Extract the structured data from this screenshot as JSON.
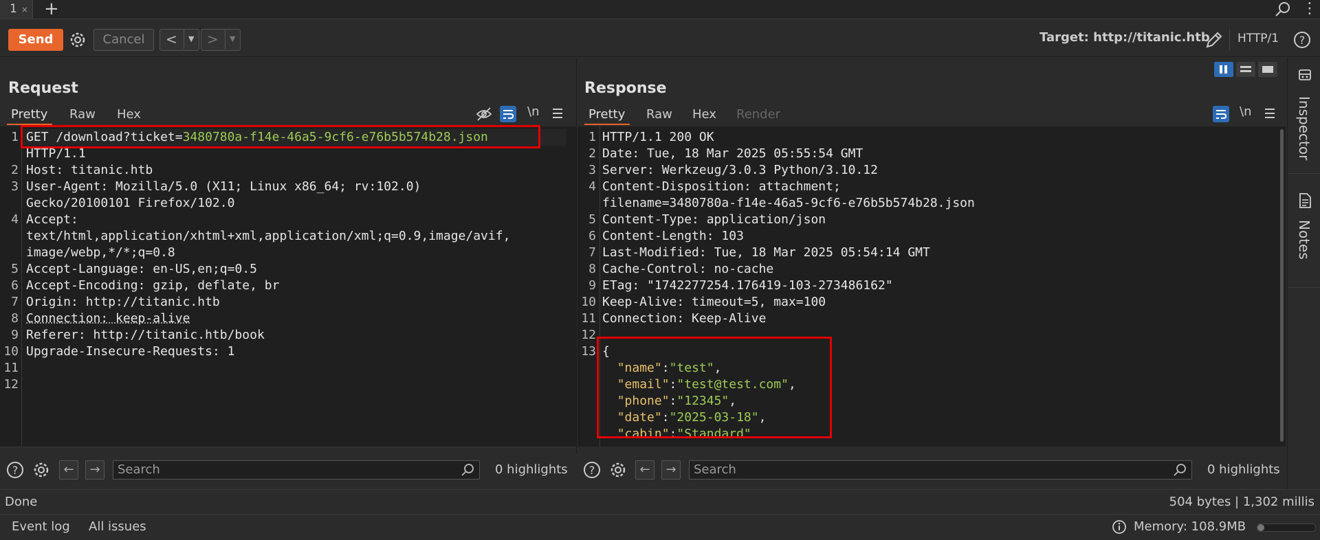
{
  "tabs": [
    {
      "label": "1",
      "close": "×"
    }
  ],
  "toolbar": {
    "send": "Send",
    "cancel": "Cancel",
    "target_label": "Target: http://titanic.htb",
    "http_version": "HTTP/1"
  },
  "request": {
    "title": "Request",
    "tabs": [
      "Pretty",
      "Raw",
      "Hex"
    ],
    "line_numbers": [
      "1",
      "2",
      "3",
      "4",
      "5",
      "6",
      "7",
      "8",
      "9",
      "10",
      "11",
      "12"
    ],
    "lines": {
      "l1_method": "GET /download?ticket=",
      "l1_ticket": "3480780a-f14e-46a5-9cf6-e76b5b574b28.json",
      "l1b": "HTTP/1.1",
      "l2_k": "Host",
      "l2_v": ": titanic.htb",
      "l3_k": "User-Agent",
      "l3_v": ": Mozilla/5.0 (X11; Linux x86_64; rv:102.0)",
      "l3b": "Gecko/20100101 Firefox/102.0",
      "l4_k": "Accept",
      "l4_v": ":",
      "l4b": "text/html,application/xhtml+xml,application/xml;q=0.9,image/avif,",
      "l4c": "image/webp,*/*;q=0.8",
      "l5_k": "Accept-Language",
      "l5_v": ": en-US,en;q=0.5",
      "l6_k": "Accept-Encoding",
      "l6_v": ": gzip, deflate, br",
      "l7_k": "Origin",
      "l7_v": ": http://titanic.htb",
      "l8_k": "Connection",
      "l8_v": ": keep-alive",
      "l9_k": "Referer",
      "l9_v": ": http://titanic.htb/book",
      "l10_k": "Upgrade-Insecure-Requests",
      "l10_v": ": 1"
    },
    "search_placeholder": "Search",
    "highlights": "0 highlights"
  },
  "response": {
    "title": "Response",
    "tabs": [
      "Pretty",
      "Raw",
      "Hex",
      "Render"
    ],
    "line_numbers": [
      "1",
      "2",
      "3",
      "4",
      "5",
      "6",
      "7",
      "8",
      "9",
      "10",
      "11",
      "12",
      "13"
    ],
    "lines": {
      "l1": "HTTP/1.1 200 OK",
      "l2_k": "Date",
      "l2_v": ": Tue, 18 Mar 2025 05:55:54 GMT",
      "l3_k": "Server",
      "l3_v": ": Werkzeug/3.0.3 Python/3.10.12",
      "l4_k": "Content-Disposition",
      "l4_v": ": attachment;",
      "l4b": "filename=3480780a-f14e-46a5-9cf6-e76b5b574b28.json",
      "l5_k": "Content-Type",
      "l5_v": ": application/json",
      "l6_k": "Content-Length",
      "l6_v": ": 103",
      "l7_k": "Last-Modified",
      "l7_v": ": Tue, 18 Mar 2025 05:54:14 GMT",
      "l8_k": "Cache-Control",
      "l8_v": ": no-cache",
      "l9_k": "ETag",
      "l9_v": ": \"1742277254.176419-103-273486162\"",
      "l10_k": "Keep-Alive",
      "l10_v": ": timeout=5, max=100",
      "l11_k": "Connection",
      "l11_v": ": Keep-Alive",
      "l13": "{",
      "j1_k": "\"name\"",
      "j1_v": "\"test\"",
      "j2_k": "\"email\"",
      "j2_v": "\"test@test.com\"",
      "j3_k": "\"phone\"",
      "j3_v": "\"12345\"",
      "j4_k": "\"date\"",
      "j4_v": "\"2025-03-18\"",
      "j5_k": "\"cabin\"",
      "j5_v": "\"Standard\"",
      "close": "}"
    },
    "search_placeholder": "Search",
    "highlights": "0 highlights"
  },
  "side_panel": {
    "inspector": "Inspector",
    "notes": "Notes"
  },
  "status": {
    "left": "Done",
    "right": "504 bytes | 1,302 millis"
  },
  "footer": {
    "event_log": "Event log",
    "all_issues": "All issues",
    "memory": "Memory: 108.9MB"
  },
  "colors": {
    "accent": "#e8652c",
    "highlight_box": "#e00000",
    "json_key": "#e8c06a",
    "json_string": "#9ecb55",
    "active_toggle": "#2d6cb5"
  }
}
